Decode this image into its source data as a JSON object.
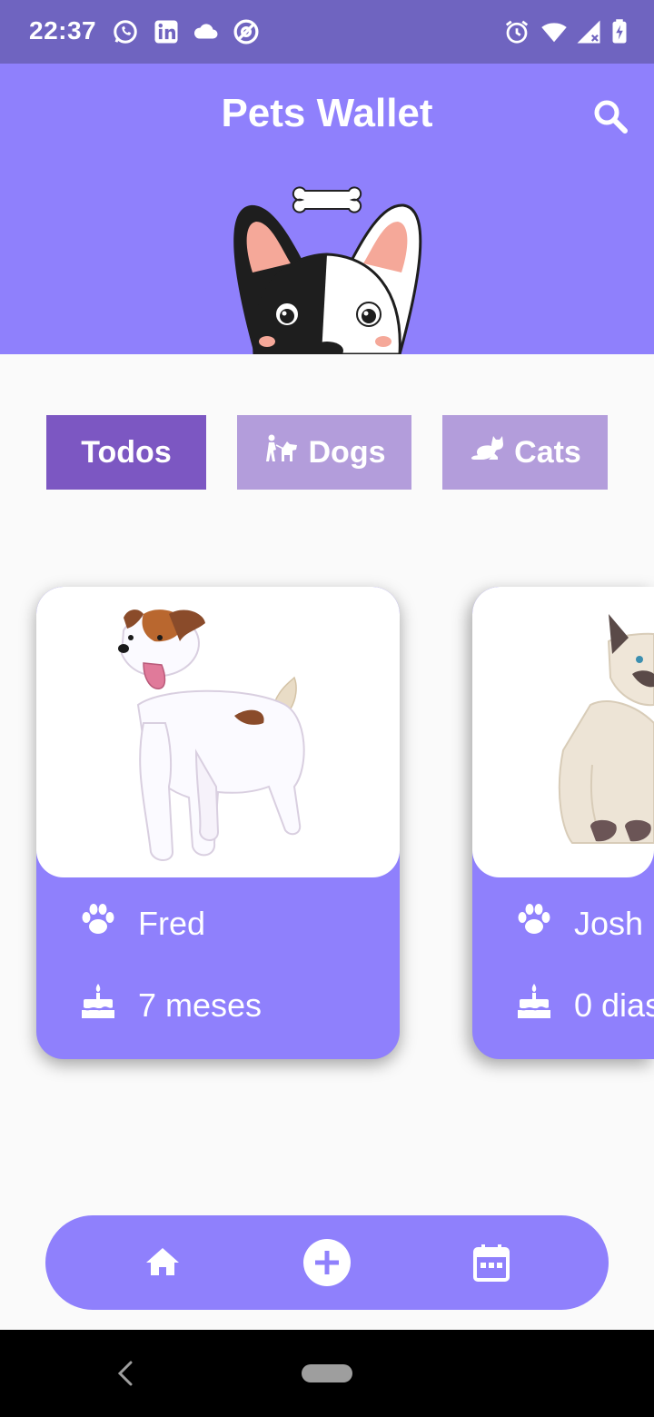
{
  "status_bar": {
    "time": "22:37",
    "left_icons": [
      "whatsapp-icon",
      "linkedin-icon",
      "cloud-icon",
      "at-sign-icon"
    ],
    "right_icons": [
      "alarm-icon",
      "wifi-icon",
      "signal-icon",
      "battery-icon"
    ]
  },
  "header": {
    "title": "Pets Wallet",
    "search_icon": "search-icon",
    "background": "#8f80fc"
  },
  "filters": [
    {
      "label": "Todos",
      "icon": "",
      "state": "active"
    },
    {
      "label": "Dogs",
      "icon": "dog-walk-icon",
      "state": "inactive"
    },
    {
      "label": "Cats",
      "icon": "cat-icon",
      "state": "inactive"
    }
  ],
  "pets": [
    {
      "name": "Fred",
      "age": "7 meses",
      "species": "dog"
    },
    {
      "name": "Josh",
      "age": "0 dias",
      "species": "cat"
    }
  ],
  "bottom_nav": {
    "items": [
      "home-icon",
      "add-circle-icon",
      "calendar-icon"
    ]
  },
  "colors": {
    "status_bar": "#6f64c0",
    "accent": "#8f80fc",
    "filter_active": "#7c57c2",
    "filter_inactive": "#b39ddb"
  }
}
